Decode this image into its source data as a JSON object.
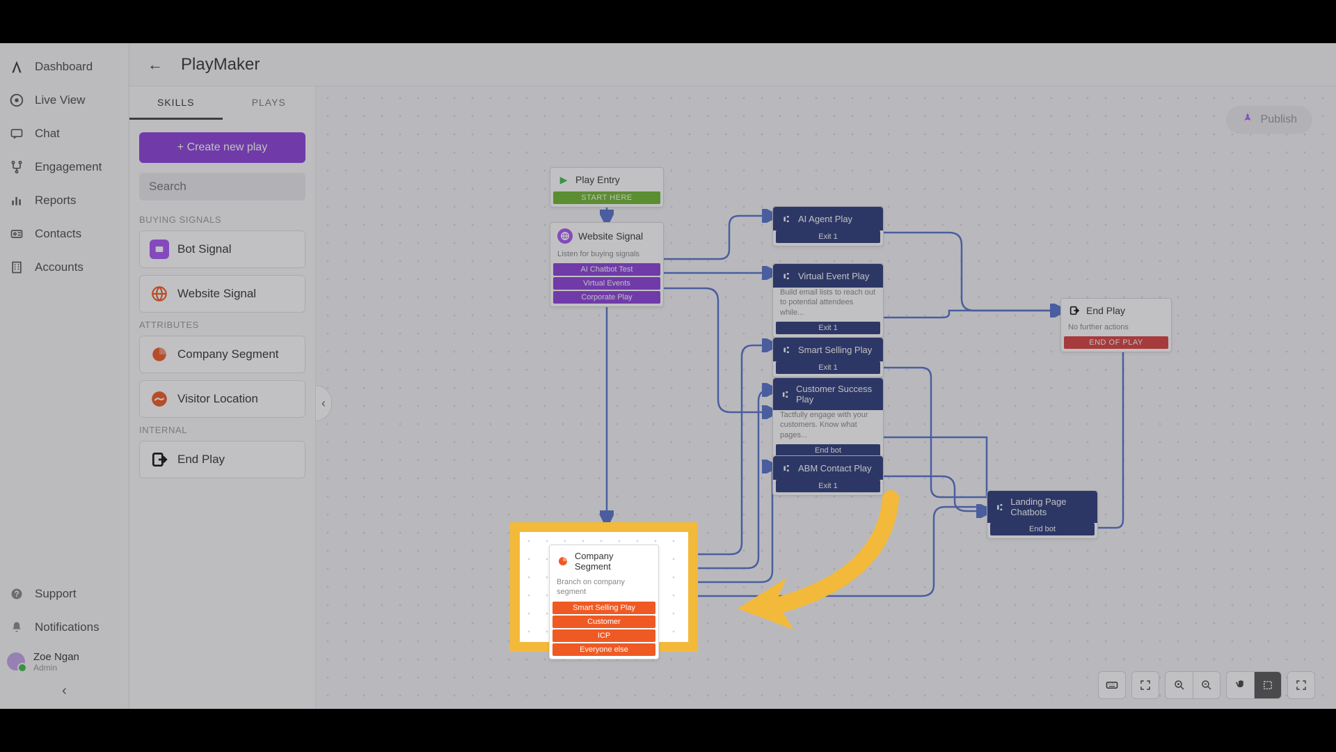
{
  "sidebar": {
    "items": [
      {
        "label": "Dashboard",
        "icon": "logo-icon"
      },
      {
        "label": "Live View",
        "icon": "eye-icon"
      },
      {
        "label": "Chat",
        "icon": "chat-icon"
      },
      {
        "label": "Engagement",
        "icon": "route-icon"
      },
      {
        "label": "Reports",
        "icon": "barchart-icon"
      },
      {
        "label": "Contacts",
        "icon": "card-icon"
      },
      {
        "label": "Accounts",
        "icon": "building-icon"
      }
    ],
    "footer": {
      "support": "Support",
      "notifications": "Notifications"
    },
    "user": {
      "name": "Zoe Ngan",
      "role": "Admin"
    }
  },
  "header": {
    "title": "PlayMaker",
    "publish": "Publish"
  },
  "panel": {
    "tabs": {
      "skills": "SKILLS",
      "plays": "PLAYS"
    },
    "create_btn": "+ Create new play",
    "search_placeholder": "Search",
    "sections": {
      "buying_signals": "BUYING SIGNALS",
      "attributes": "ATTRIBUTES",
      "internal": "INTERNAL"
    },
    "skills": {
      "bot_signal": "Bot Signal",
      "website_signal": "Website Signal",
      "company_segment": "Company Segment",
      "visitor_location": "Visitor Location",
      "end_play": "End Play"
    }
  },
  "nodes": {
    "play_entry": {
      "title": "Play Entry",
      "bar": "START HERE"
    },
    "website_signal": {
      "title": "Website Signal",
      "subtitle": "Listen for buying signals",
      "bars": [
        "AI Chatbot Test",
        "Virtual Events",
        "Corporate Play"
      ]
    },
    "company_segment": {
      "title": "Company Segment",
      "subtitle": "Branch on company segment",
      "bars": [
        "Smart Selling Play",
        "Customer",
        "ICP",
        "Everyone else"
      ]
    },
    "ai_agent": {
      "title": "AI Agent Play",
      "bar": "Exit 1"
    },
    "virtual_event": {
      "title": "Virtual Event Play",
      "subtitle": "Build email lists to reach out to potential attendees while...",
      "bar": "Exit 1"
    },
    "smart_selling": {
      "title": "Smart Selling Play",
      "bar": "Exit 1"
    },
    "customer_success": {
      "title": "Customer Success Play",
      "subtitle": "Tactfully engage with your customers. Know what pages...",
      "bar": "End bot"
    },
    "abm_contact": {
      "title": "ABM Contact Play",
      "bar": "Exit 1"
    },
    "landing_page": {
      "title": "Landing Page Chatbots",
      "bar": "End bot"
    },
    "end_play": {
      "title": "End Play",
      "subtitle": "No further actions",
      "bar": "END OF PLAY"
    }
  },
  "toolbar": {
    "keyboard": "keyboard-icon",
    "fit": "fit-icon",
    "zoomin": "zoomin-icon",
    "zoomout": "zoomout-icon",
    "pan": "hand-icon",
    "select": "select-icon",
    "fullscreen": "fullscreen-icon"
  }
}
